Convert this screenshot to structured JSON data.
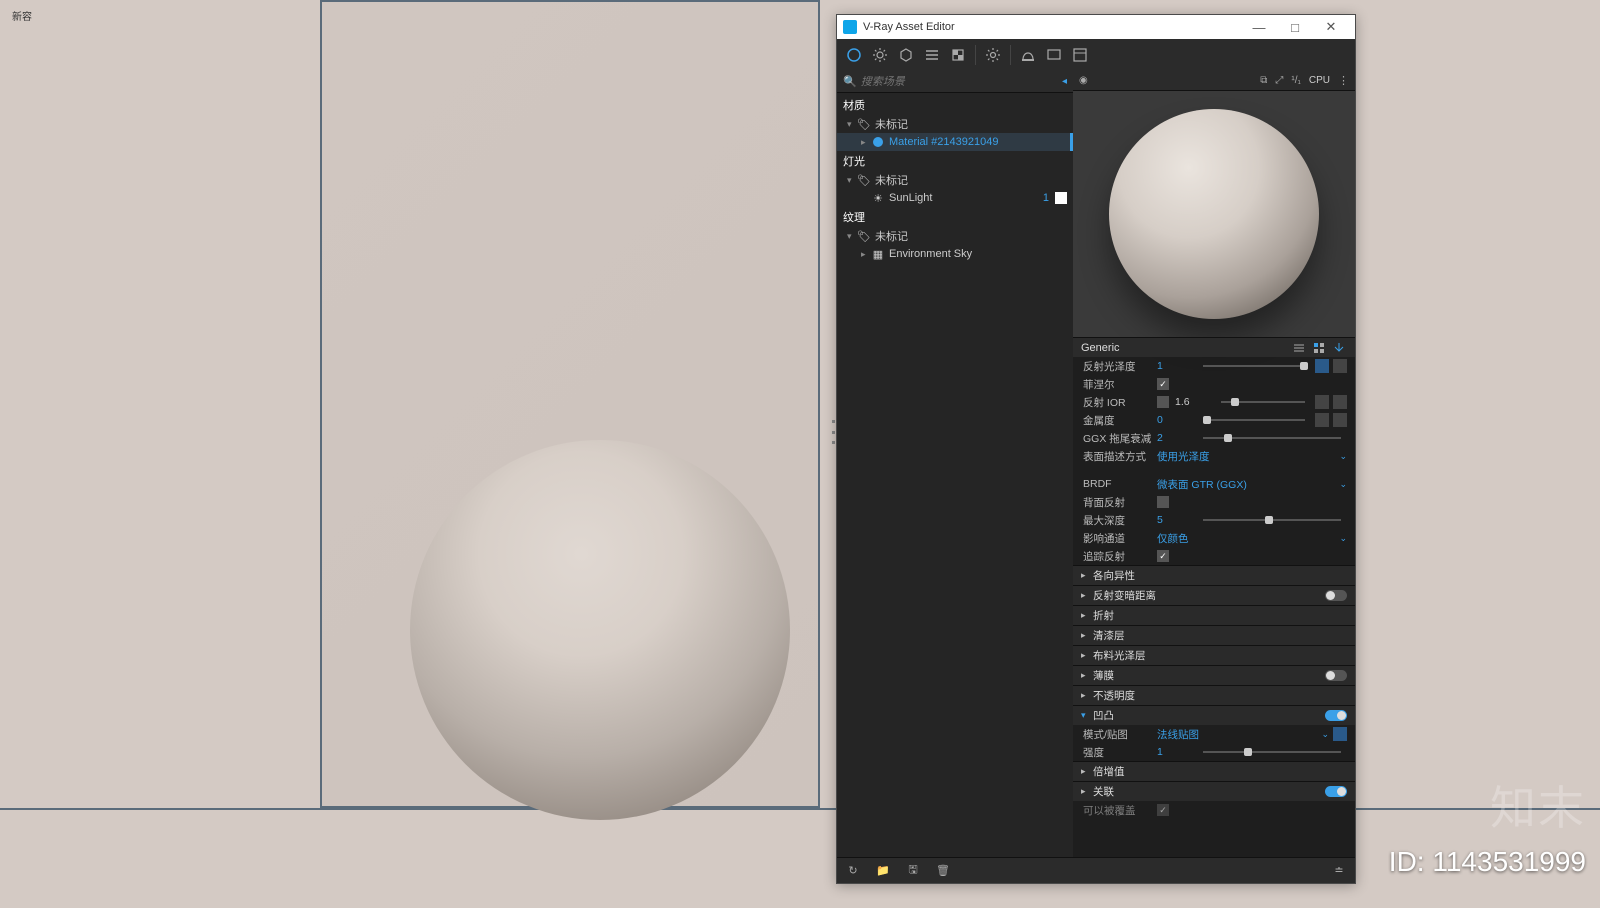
{
  "topLabel": "新容",
  "window": {
    "title": "V-Ray Asset Editor",
    "cpuLabel": "CPU",
    "oneOverOne": "¹/₁"
  },
  "search": {
    "placeholder": "搜索场景"
  },
  "tree": {
    "cat_material": "材质",
    "cat_light": "灯光",
    "cat_texture": "纹理",
    "untagged": "未标记",
    "material_name": "Material #2143921049",
    "sunlight": "SunLight",
    "sunlight_val": "1",
    "envsky": "Environment Sky"
  },
  "propsHeader": "Generic",
  "props": {
    "reflGloss": "反射光泽度",
    "reflGloss_val": "1",
    "fresnel": "菲涅尔",
    "reflIOR": "反射 IOR",
    "reflIOR_val": "1.6",
    "metalness": "金属度",
    "metalness_val": "0",
    "ggxTail": "GGX 拖尾衰减",
    "ggxTail_val": "2",
    "surfaceDesc": "表面描述方式",
    "surfaceDesc_val": "使用光泽度",
    "brdf": "BRDF",
    "brdf_val": "微表面 GTR (GGX)",
    "backRefl": "背面反射",
    "maxDepth": "最大深度",
    "maxDepth_val": "5",
    "affectCh": "影响通道",
    "affectCh_val": "仅颜色",
    "traceRefl": "追踪反射",
    "anisotropy": "各向异性",
    "dimDistance": "反射变暗距离",
    "refraction": "折射",
    "clearcoat": "清漆层",
    "sheen": "布料光泽层",
    "thinfilm": "薄膜",
    "opacity": "不透明度",
    "bump": "凹凸",
    "bumpMode": "模式/贴图",
    "bumpMode_val": "法线贴图",
    "bumpIntensity": "强度",
    "bumpIntensity_val": "1",
    "multiplier": "倍增值",
    "relation": "关联",
    "canOverride": "可以被覆盖"
  },
  "brand": "知末",
  "idLabel": "ID: 1143531999"
}
